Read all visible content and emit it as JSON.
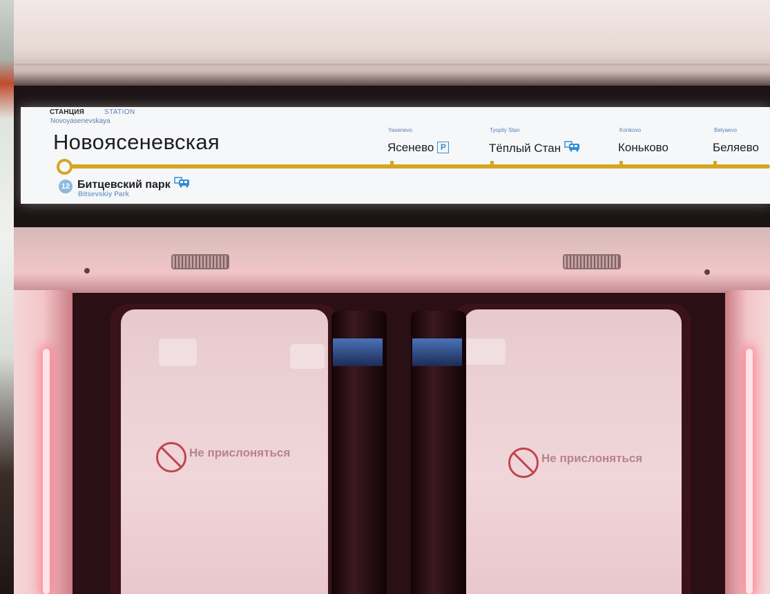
{
  "display": {
    "station_label_ru": "СТАНЦИЯ",
    "station_label_en": "STATION",
    "current_station_en": "Novoyasenevskaya",
    "current_station_ru": "Новоясеневская",
    "line_color": "#d3a623",
    "stops": [
      {
        "en": "Yasenevo",
        "ru": "Ясенево",
        "icon": "parking-icon",
        "icon_text": "P"
      },
      {
        "en": "Tyopliy Stan",
        "ru": "Тёплый Стан",
        "icon": "bus-transfer-icon"
      },
      {
        "en": "Konkovo",
        "ru": "Коньково"
      },
      {
        "en": "Belyaevo",
        "ru": "Беляево"
      }
    ],
    "transfer": {
      "line_number": "12",
      "station_ru": "Битцевский парк",
      "station_en": "Bitsevskiy Park",
      "badge_color": "#8fb8dd",
      "icon": "bus-transfer-icon"
    }
  },
  "doors": {
    "sign_text": "Не прислоняться",
    "sign_icon": "no-leaning-icon"
  }
}
